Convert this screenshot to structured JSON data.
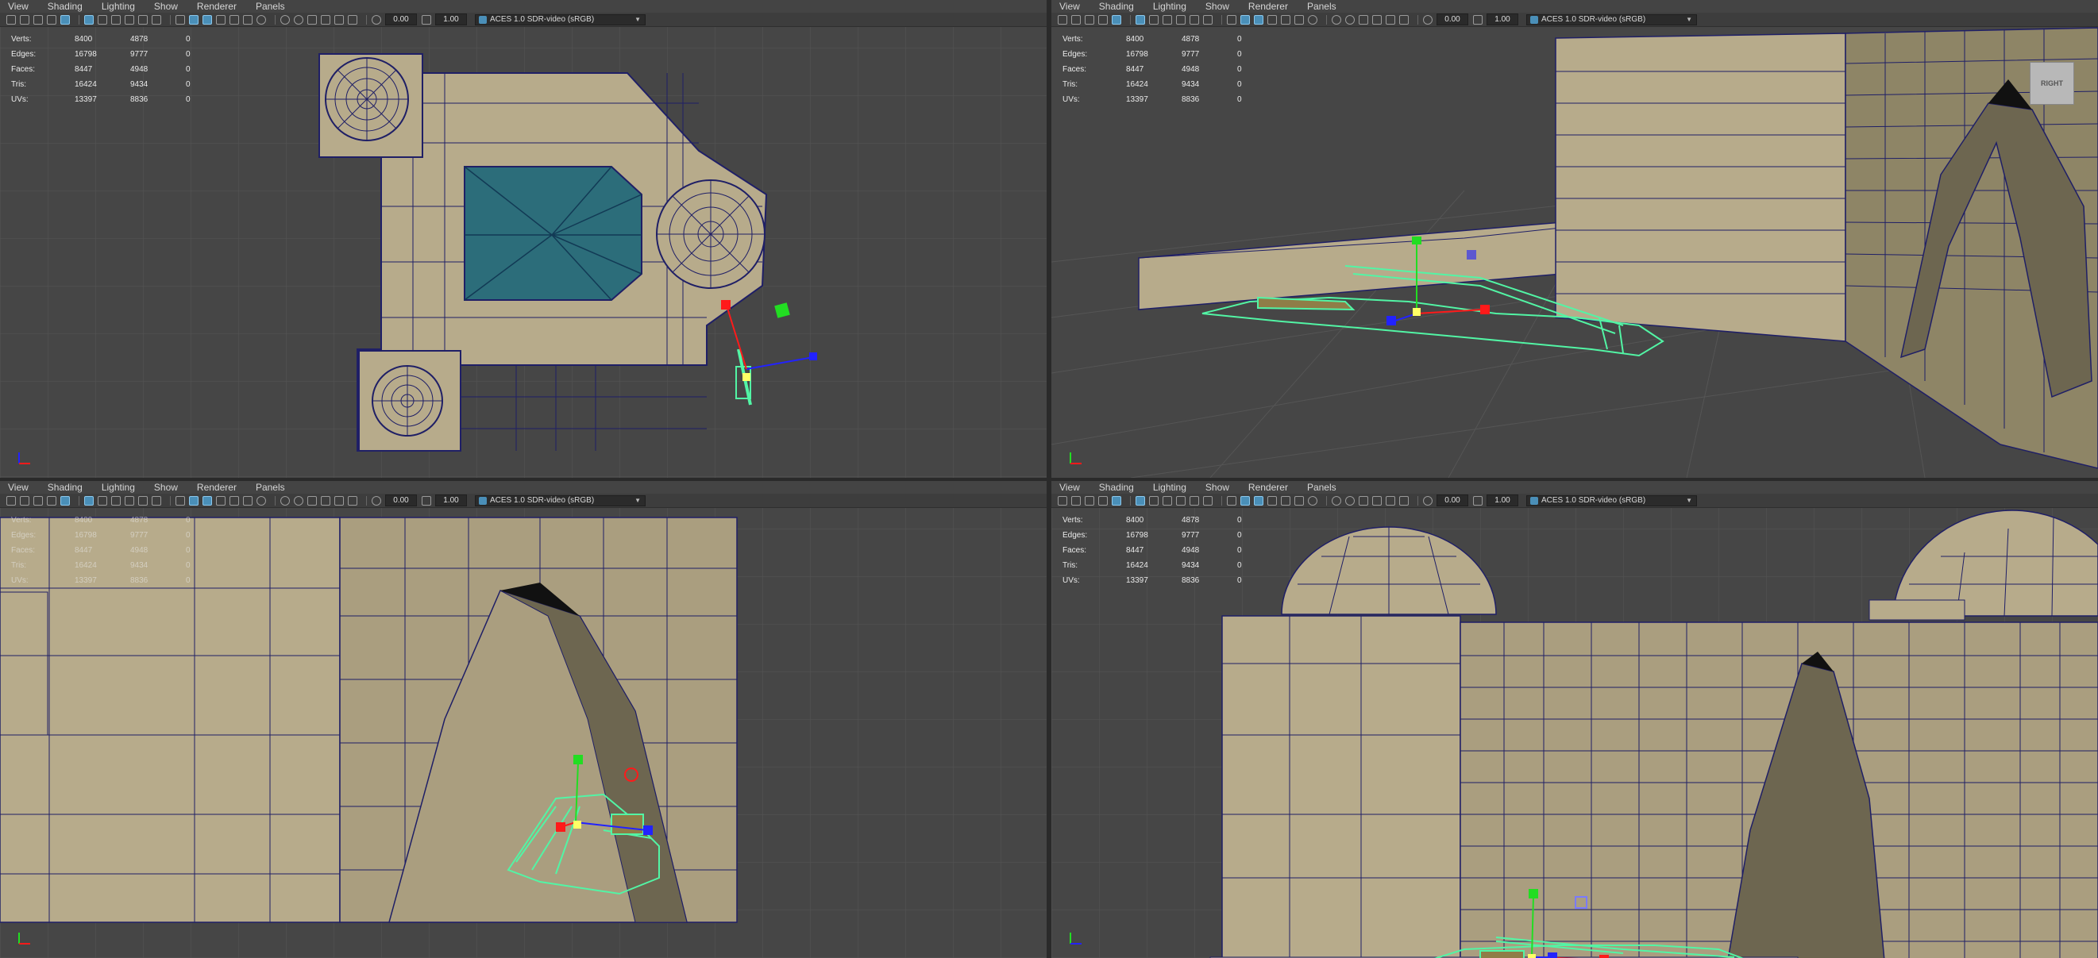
{
  "menus": [
    "View",
    "Shading",
    "Lighting",
    "Show",
    "Renderer",
    "Panels"
  ],
  "toolbar": {
    "exposure_value": "0.00",
    "gamma_value": "1.00",
    "color_space": "ACES 1.0 SDR-video (sRGB)"
  },
  "hud": {
    "rows": [
      {
        "label": "Verts:",
        "a": "8400",
        "b": "4878",
        "c": "0"
      },
      {
        "label": "Edges:",
        "a": "16798",
        "b": "9777",
        "c": "0"
      },
      {
        "label": "Faces:",
        "a": "8447",
        "b": "4948",
        "c": "0"
      },
      {
        "label": "Tris:",
        "a": "16424",
        "b": "9434",
        "c": "0"
      },
      {
        "label": "UVs:",
        "a": "13397",
        "b": "8836",
        "c": "0"
      }
    ]
  },
  "viewcube_label": "RIGHT",
  "colors": {
    "viewport_bg": "#464646",
    "grid_line": "#555555",
    "mesh_fill": "#b7ab8b",
    "wire": "#1f1f66",
    "glass": "#2c6d7a",
    "selection": "#52f5a5",
    "manip_x": "#ff1a1a",
    "manip_y": "#22dd22",
    "manip_z": "#2222ff"
  },
  "viewports": [
    {
      "name": "top-ortho"
    },
    {
      "name": "perspective"
    },
    {
      "name": "front-ortho"
    },
    {
      "name": "side-ortho"
    }
  ]
}
